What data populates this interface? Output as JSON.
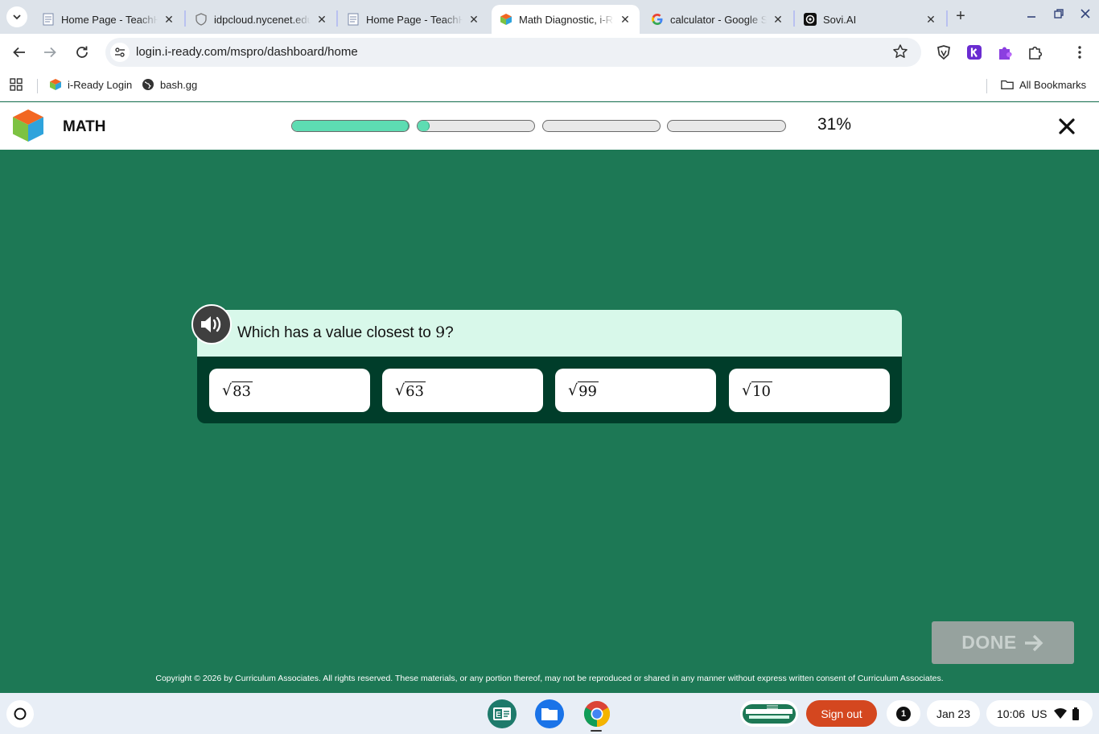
{
  "browser": {
    "tabs": [
      {
        "title": "Home Page - TeachHub",
        "icon": "document-icon",
        "active": false
      },
      {
        "title": "idpcloud.nycenet.edu",
        "icon": "shield-icon",
        "active": false
      },
      {
        "title": "Home Page - TeachHub",
        "icon": "document-icon",
        "active": false
      },
      {
        "title": "Math Diagnostic, i-Ready",
        "icon": "iready-cube-icon",
        "active": true
      },
      {
        "title": "calculator - Google Search",
        "icon": "google-icon",
        "active": false
      },
      {
        "title": "Sovi.AI",
        "icon": "sovi-icon",
        "active": false
      }
    ],
    "new_tab": "+",
    "url": "login.i-ready.com/mspro/dashboard/home",
    "bookmarks": [
      {
        "label": "i-Ready Login",
        "icon": "iready-cube-icon"
      },
      {
        "label": "bash.gg",
        "icon": "globe-icon"
      }
    ],
    "all_bookmarks": "All Bookmarks"
  },
  "app": {
    "subject": "MATH",
    "progress_percent": "31%",
    "progress_bars": [
      {
        "fill": 1.0
      },
      {
        "fill": 0.1
      },
      {
        "fill": 0.0
      },
      {
        "fill": 0.0
      }
    ],
    "colors": {
      "background": "#1d7855",
      "progress_fill": "#5ddcb2",
      "question_header": "#d8f8ea",
      "card_body": "#003d2a"
    }
  },
  "question": {
    "prompt": "Which has a value closest to ",
    "target": "9",
    "suffix": "?",
    "choices": [
      "83",
      "63",
      "99",
      "10"
    ]
  },
  "done_label": "DONE",
  "copyright": "Copyright © 2026 by Curriculum Associates. All rights reserved. These materials, or any portion thereof, may not be reproduced or shared in any manner without express written consent of Curriculum Associates.",
  "shelf": {
    "sign_out": "Sign out",
    "notification_count": "1",
    "date": "Jan 23",
    "time": "10:06",
    "locale": "US"
  }
}
